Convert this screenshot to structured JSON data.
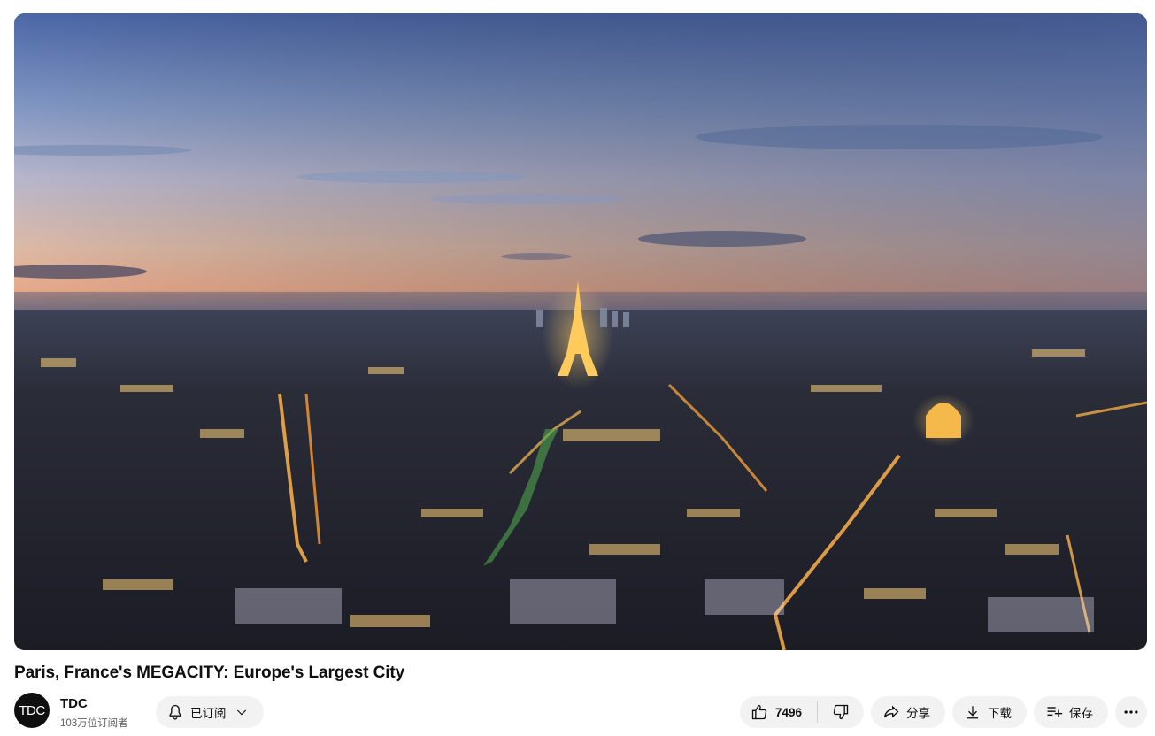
{
  "video": {
    "title": "Paris, France's MEGACITY: Europe's Largest City",
    "scene_description": "dusk aerial city view"
  },
  "channel": {
    "avatar_text": "TDC",
    "name": "TDC",
    "subscribers": "103万位订阅者"
  },
  "actions": {
    "subscribed_label": "已订阅",
    "like_count": "7496",
    "share_label": "分享",
    "download_label": "下载",
    "save_label": "保存"
  },
  "icons": {
    "bell": "bell-icon",
    "chevron": "chevron-down-icon",
    "like": "thumbs-up-icon",
    "dislike": "thumbs-down-icon",
    "share": "share-arrow-icon",
    "download": "download-icon",
    "save": "playlist-add-icon",
    "more": "more-horizontal-icon"
  },
  "colors": {
    "pill_bg": "#f2f2f2",
    "text": "#0f0f0f",
    "muted": "#606060"
  }
}
